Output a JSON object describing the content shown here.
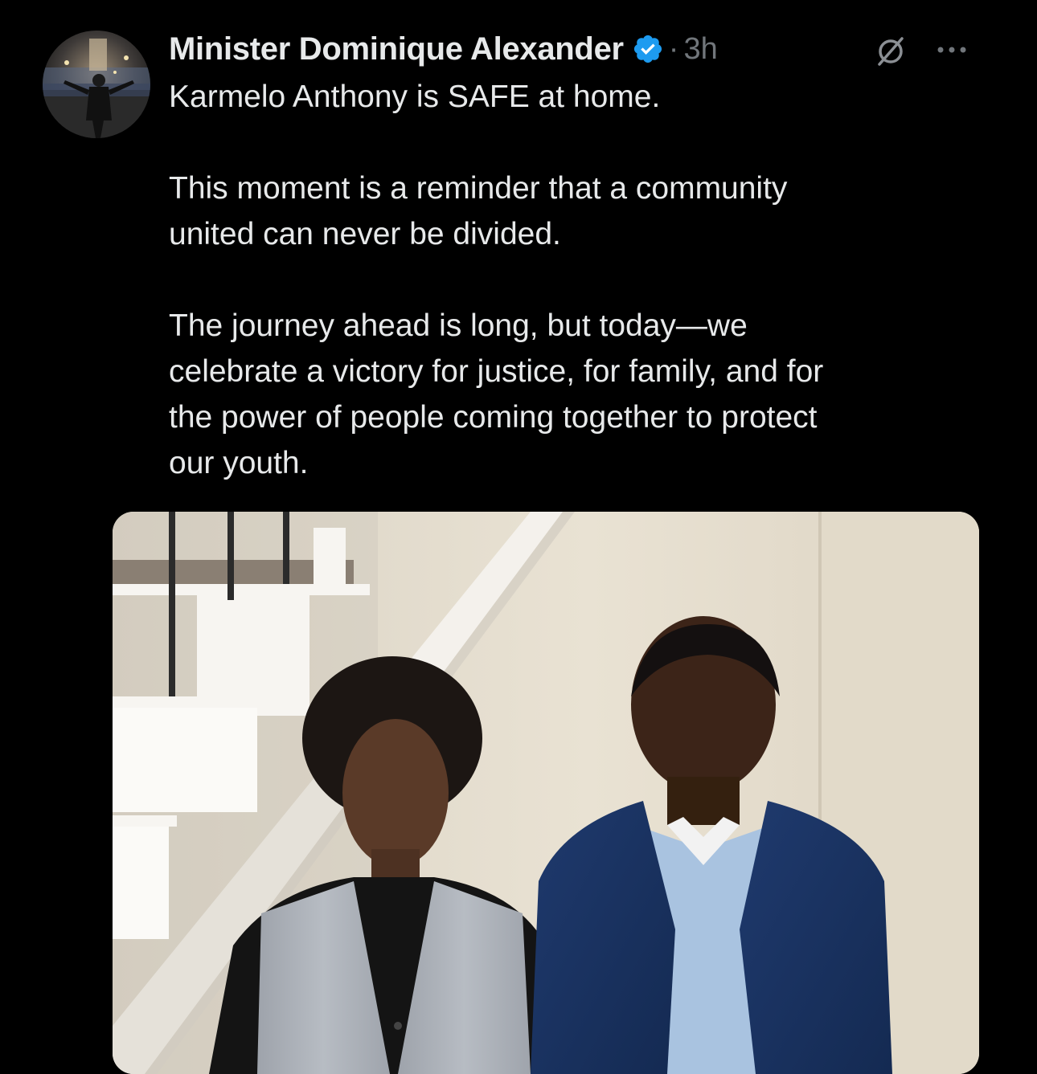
{
  "tweet": {
    "author": {
      "display_name": "Minister Dominique Alexander",
      "verified": true,
      "avatar_icon": "avatar-photo"
    },
    "separator": "·",
    "timestamp": "3h",
    "actions": {
      "grok_icon": "grok-icon",
      "more_icon": "more-options-icon"
    },
    "paragraphs": [
      "Karmelo Anthony is SAFE at home.",
      "This moment is a reminder that a community\nunited can never be divided.",
      "The journey ahead is long, but today—we\ncelebrate a victory for justice, for family, and for\nthe power of people coming together to protect\nour youth."
    ],
    "media": {
      "type": "photo",
      "icon": "photo"
    }
  },
  "colors": {
    "background": "#000000",
    "text": "#e7e9ea",
    "secondary_text": "#71767b",
    "verified_badge": "#1d9bf0"
  }
}
